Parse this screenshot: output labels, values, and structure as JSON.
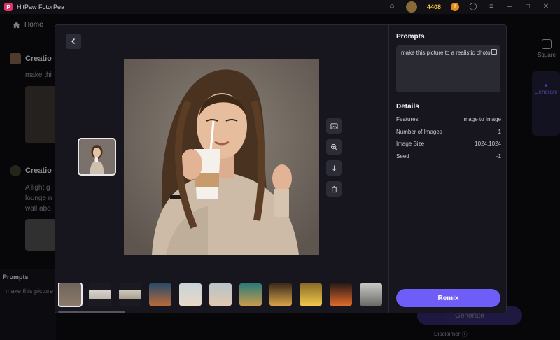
{
  "app": {
    "title": "HitPaw FotorPea",
    "logo_letter": "P",
    "coins": "4408"
  },
  "nav": {
    "home_label": "Home"
  },
  "background": {
    "card1_title": "Creatio",
    "card1_text": "make thi",
    "card2_title": "Creatio",
    "card2_text_lines": [
      "A light g",
      "lounge n",
      "wall abo"
    ],
    "prompts_label": "Prompts",
    "prompts_value": "make this picture",
    "square_label": "Square",
    "generate_tab_label": "Generate",
    "generate_button": "Generate",
    "disclaimer": "Disclaimer"
  },
  "modal": {
    "prompts_title": "Prompts",
    "prompt_text": "make this picture to a realistic photo",
    "details_title": "Details",
    "details": [
      {
        "label": "Features",
        "value": "Image to Image"
      },
      {
        "label": "Number of Images",
        "value": "1"
      },
      {
        "label": "Image Size",
        "value": "1024,1024"
      },
      {
        "label": "Seed",
        "value": "-1"
      }
    ],
    "remix_label": "Remix",
    "strip_count": 11
  },
  "colors": {
    "accent": "#6e5df7",
    "panel": "#17161f",
    "surface": "#2a2a33"
  }
}
